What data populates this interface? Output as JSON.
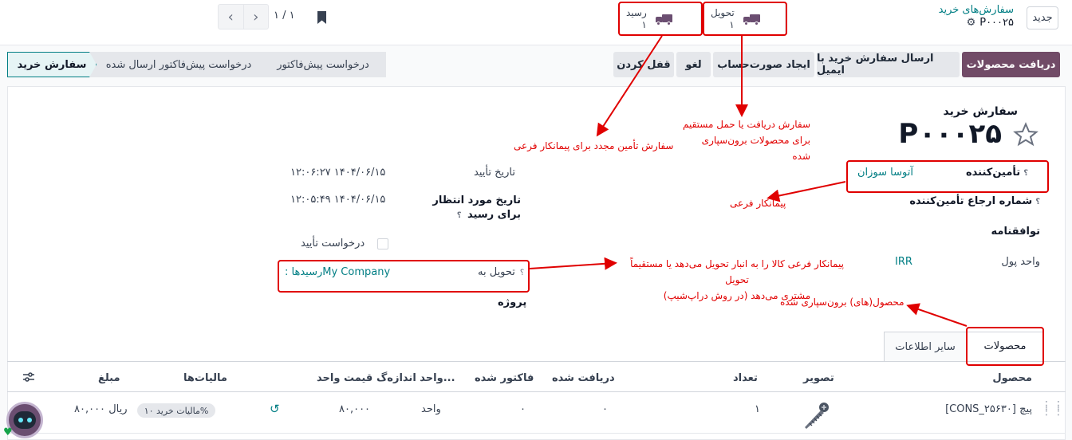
{
  "topbar": {
    "new_button": "جدید",
    "breadcrumb_parent": "سفارش‌های خرید",
    "breadcrumb_record": "P۰۰۰۲۵",
    "pager": "۱ / ۱",
    "smart_delivery": {
      "label": "تحویل",
      "count": "۱"
    },
    "smart_receipt": {
      "label": "رسید",
      "count": "۱"
    }
  },
  "actions": {
    "receive": "دریافت محصولات",
    "send_email": "ارسال سفارش خرید با ایمیل",
    "create_bill": "ایجاد صورت‌حساب",
    "cancel": "لغو",
    "lock": "قفل کردن"
  },
  "status": {
    "stages": [
      "سفارش خرید",
      "درخواست پیش‌فاکتور ارسال شده",
      "درخواست پیش‌فاکتور"
    ],
    "current": "سفارش خرید"
  },
  "form": {
    "heading": "سفارش خرید",
    "record_name": "P۰۰۰۲۵",
    "vendor_label": "تأمین‌کننده",
    "vendor_value": "آتوسا سوزان",
    "vendor_ref_label": "شماره ارجاع تأمین‌کننده",
    "agreement_label": "توافقنامه",
    "currency_label": "واحد پول",
    "currency_value": "IRR",
    "confirm_date_label": "تاریخ تأیید",
    "confirm_date_value": "۱۲:۰۶:۲۷ ۱۴۰۴/۰۶/۱۵",
    "expected_date_label": "تاریخ مورد انتظار برای رسید",
    "expected_date_value": "۱۲:۰۵:۴۹ ۱۴۰۴/۰۶/۱۵",
    "ack_label": "درخواست تأیید",
    "deliver_to_label": "تحویل به",
    "deliver_to_company": "My Company",
    "deliver_to_receipts": ": رسیدها",
    "project_label": "پروژه"
  },
  "annotations": {
    "resupply": "سفارش تأمین مجدد برای پیمانکار فرعی",
    "dropship_1": "سفارش دریافت یا حمل مستقیم",
    "dropship_2": "برای محصولات برون‌سپاری شده",
    "subcontractor": "پیمانکار فرعی",
    "deliver_1": "پیمانکار فرعی کالا را به انبار تحویل می‌دهد یا مستقیماً تحویل",
    "deliver_2": "مشتری می‌دهد (در روش دراپ‌شیپ)",
    "subcontracted_products": "محصول(های) برون‌سپاری شده"
  },
  "tabs": {
    "products": "محصولات",
    "other_info": "سایر اطلاعات"
  },
  "table": {
    "headers": {
      "product": "محصول",
      "image": "تصویر",
      "qty": "تعداد",
      "received": "دریافت شده",
      "billed": "فاکتور شده",
      "uom": "واحد اندازه‌گ...",
      "unit_price": "قیمت واحد",
      "taxes": "مالیات‌ها",
      "amount": "مبلغ"
    },
    "rows": [
      {
        "product": "[CONS_۲۵۶۳۰] پیچ",
        "qty": "۱",
        "received": "۰",
        "billed": "۰",
        "uom": "واحد",
        "unit_price": "۸۰,۰۰۰",
        "tax": "مالیات خرید ۱۰%",
        "amount": "۸۰,۰۰۰ ریال"
      }
    ]
  },
  "colors": {
    "brand": "#714b67",
    "link": "#017e84",
    "annotation": "#e00000"
  },
  "icons": [
    "truck-icon",
    "gear-icon",
    "bookmark-icon",
    "star-icon",
    "chevron-left-icon",
    "chevron-right-icon",
    "settings-sliders-icon",
    "drag-handle-icon",
    "refresh-icon",
    "screw-image",
    "chat-avatar"
  ]
}
